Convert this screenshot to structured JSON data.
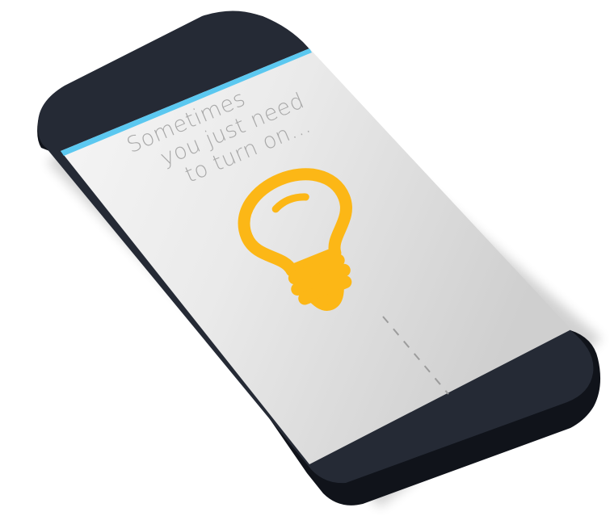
{
  "screen": {
    "tagline_lines": [
      "Sometimes",
      "you just need",
      "to turn on..."
    ]
  },
  "colors": {
    "phone_body": "#252a35",
    "phone_edge": "#10131a",
    "screen_light": "#f4f4f4",
    "screen_dark": "#d3d3d3",
    "status_bar_accent": "#5bc8f0",
    "bulb": "#fcb716",
    "text": "#a9a9a9",
    "cord": "#9c9c9c"
  },
  "icons": {
    "bulb": "lightbulb-icon"
  }
}
